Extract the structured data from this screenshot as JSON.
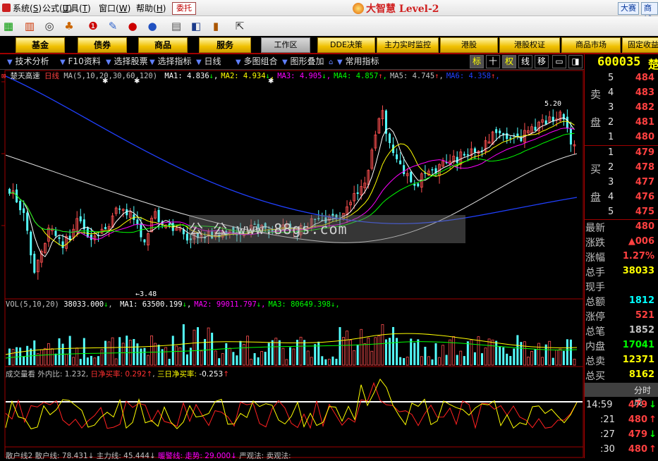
{
  "menubar": {
    "items": [
      {
        "label": "系统",
        "key": "S"
      },
      {
        "label": "公式",
        "key": "U"
      },
      {
        "label": "工具",
        "key": "T"
      },
      {
        "label": "窗口",
        "key": "W"
      },
      {
        "label": "帮助",
        "key": "H"
      }
    ],
    "weituo_label": "委托",
    "brand": "大智慧 Level-2",
    "right_btns": [
      "大赛",
      "商城"
    ]
  },
  "nav": {
    "buttons": [
      "基金",
      "债券",
      "商品",
      "服务"
    ],
    "workspace": "工作区",
    "tabs": [
      "DDE决策",
      "主力实时监控",
      "港股",
      "港股权证",
      "商品市场",
      "固定收益"
    ]
  },
  "subbar": {
    "items": [
      "技术分析",
      "F10资料",
      "选择股票",
      "选择指标",
      "日线",
      "多图组合",
      "图形叠加",
      "常用指标"
    ],
    "box_btns": [
      "标",
      "十",
      "权",
      "线",
      "移",
      "▭",
      "◨"
    ]
  },
  "price_panel": {
    "stock": "楚天高速",
    "period": "日线",
    "ma_def": "MA(5,10,20,30,60,120)",
    "ma": [
      {
        "label": "MA1:",
        "value": "4.836",
        "arrow": "↓",
        "color": "#ffffff"
      },
      {
        "label": "MA2:",
        "value": "4.934",
        "arrow": "↓",
        "color": "#ffff00"
      },
      {
        "label": "MA3:",
        "value": "4.905",
        "arrow": "↓",
        "color": "#ff00ff"
      },
      {
        "label": "MA4:",
        "value": "4.857",
        "arrow": "↑",
        "color": "#00ff00"
      },
      {
        "label": "MA5:",
        "value": "4.745",
        "arrow": "↑",
        "color": "#c0c0c0"
      },
      {
        "label": "MA6:",
        "value": "4.358",
        "arrow": "↑",
        "color": "#2040ff"
      }
    ],
    "high_label": "5.20",
    "low_label": "3.48",
    "watermark": "公 公 www.88gs.com"
  },
  "vol_panel": {
    "def": "VOL(5,10,20)",
    "value": "38033.000",
    "arrow": "↓",
    "ma": [
      {
        "label": "MA1:",
        "value": "63500.199",
        "arrow": "↓",
        "color": "#ffffff"
      },
      {
        "label": "MA2:",
        "value": "99011.797",
        "arrow": "↓",
        "color": "#ff00ff"
      },
      {
        "label": "MA3:",
        "value": "80649.398",
        "arrow": "↓",
        "color": "#00ff00"
      }
    ]
  },
  "flow_panel": {
    "title": "成交量看",
    "ratio_label": "外内比:",
    "ratio": "1.232,",
    "daily_label": "日净买率:",
    "daily": "0.292",
    "daily_arrow": "↑",
    "three_label": "三日净买率:",
    "three": "-0.253",
    "three_arrow": "↑"
  },
  "bottom_panel": {
    "parts": [
      {
        "text": "散户线2 散户线: 78.431↓",
        "color": "#c0c0c0"
      },
      {
        "text": "主力线: 45.444↓",
        "color": "#c0c0c0"
      },
      {
        "text": "暖警线: 走势: 29.000↓",
        "color": "#ff00ff"
      },
      {
        "text": "严观法: 卖观法:",
        "color": "#c0c0c0"
      }
    ]
  },
  "right": {
    "code": "600035",
    "name_initial": "楚",
    "sell_label": [
      "卖",
      "盘"
    ],
    "buy_label": [
      "买",
      "盘"
    ],
    "sell": [
      {
        "lvl": "5",
        "price": "484"
      },
      {
        "lvl": "4",
        "price": "483"
      },
      {
        "lvl": "3",
        "price": "482"
      },
      {
        "lvl": "2",
        "price": "481"
      },
      {
        "lvl": "1",
        "price": "480"
      }
    ],
    "buy": [
      {
        "lvl": "1",
        "price": "479"
      },
      {
        "lvl": "2",
        "price": "478"
      },
      {
        "lvl": "3",
        "price": "477"
      },
      {
        "lvl": "4",
        "price": "476"
      },
      {
        "lvl": "5",
        "price": "475"
      }
    ],
    "stats": [
      {
        "label": "最新",
        "value": "480",
        "color": "#ff4040"
      },
      {
        "label": "涨跌",
        "value": "▲006",
        "color": "#ff4040"
      },
      {
        "label": "涨幅",
        "value": "1.27%",
        "color": "#ff4040"
      },
      {
        "label": "总手",
        "value": "38033",
        "color": "#ffff00"
      },
      {
        "label": "现手",
        "value": "",
        "color": "#ffff00"
      },
      {
        "label": "总额",
        "value": "1812",
        "color": "#00ffff"
      },
      {
        "label": "涨停",
        "value": "521",
        "color": "#ff4040"
      },
      {
        "label": "总笔",
        "value": "1852",
        "color": "#c0c0c0"
      },
      {
        "label": "内盘",
        "value": "17041",
        "color": "#00ff00"
      },
      {
        "label": "总卖",
        "value": "12371",
        "color": "#ffff00"
      },
      {
        "label": "总买",
        "value": "8162",
        "color": "#ffff00"
      }
    ],
    "timeshare_label": "分时成",
    "ticks": [
      {
        "time": "14:59",
        "price": "479",
        "arrow": "↓"
      },
      {
        "time": ":21",
        "price": "480",
        "arrow": "↑"
      },
      {
        "time": ":27",
        "price": "479",
        "arrow": "↓"
      },
      {
        "time": ":30",
        "price": "480",
        "arrow": "↑"
      }
    ]
  },
  "colors": {
    "up": "#ff5050",
    "down": "#54ffff",
    "accent": "#f0c000"
  }
}
